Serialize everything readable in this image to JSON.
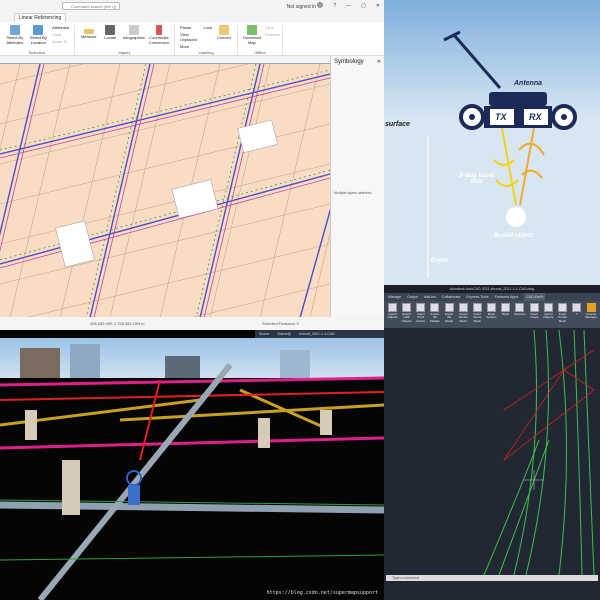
{
  "arcgis": {
    "search_placeholder": "Command search (Alt+Q)",
    "signin": "Not signed in",
    "window_controls": [
      "?",
      "—",
      "▢",
      "✕"
    ],
    "active_tab": "Linear Referencing",
    "groups": [
      {
        "label": "Selection",
        "buttons": [
          "Select By Attributes",
          "Select By Location"
        ],
        "small": [
          "Attributes",
          "Clear",
          "Zoom To"
        ]
      },
      {
        "label": "Inquiry",
        "buttons": [
          "Measure",
          "Locate",
          "Infographics",
          "Coordinate Conversion"
        ]
      },
      {
        "label": "Labeling",
        "small": [
          "Pause",
          "Lock",
          "View Unplaced",
          "More"
        ],
        "buttons": [
          "Convert"
        ]
      },
      {
        "label": "Offline",
        "buttons": [
          "Download Map"
        ],
        "small": [
          "Sync",
          "Remove"
        ]
      }
    ],
    "symbology": {
      "title": "Symbology",
      "message": "Multiple layers selected."
    },
    "status": {
      "coords": "456,589.99E 2,758,384.10N m",
      "selected": "Selected Features: 0"
    }
  },
  "gpr": {
    "antenna": "Antenna",
    "tx": "TX",
    "rx": "RX",
    "surface": "surface",
    "travel": "2-Way travel time",
    "object": "Buried object",
    "depth": "Depth"
  },
  "scene3d": {
    "tabs": [
      "Scene",
      "Scene@",
      "shrooti_2021-1-1-CAD"
    ],
    "watermark": "https://blog.csdn.net/supermapsupport"
  },
  "autocad": {
    "title": "Autodesk AutoCAD 2021   shrooti_2021-1-1-CAD.dwg",
    "tabs": [
      "Manage",
      "Output",
      "Add-ins",
      "Collaborate",
      "Express Tools",
      "Featured Apps",
      "CAD-Earth"
    ],
    "active_tab": "CAD-Earth",
    "buttons": [
      "Import Objects",
      "Export CAD Objects",
      "Insert Point Rooks",
      "Import 3D Models",
      "Export 3D Model",
      "Import Terrain Mesh",
      "Insert Vector Mesh",
      "Mesh Section",
      "Mesh",
      "Sections",
      "Insert Image",
      "Import Objects",
      "Insert Terrain Mesh",
      "?",
      "License Manager"
    ],
    "command_placeholder": "Type a command"
  }
}
